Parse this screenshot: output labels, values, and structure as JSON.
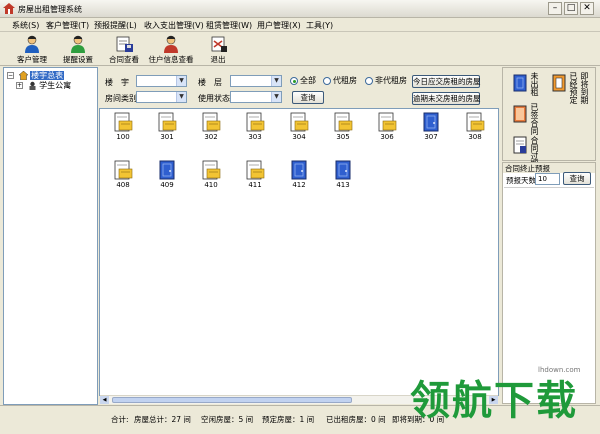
{
  "window": {
    "title": "房屋出租管理系统",
    "min_glyph": "–",
    "max_glyph": "□",
    "close_glyph": "✕"
  },
  "menu": [
    "系统(S)",
    "客户管理(T)",
    "预报提醒(L)",
    "收入支出管理(V)",
    "租赁管理(W)",
    "用户管理(X)",
    "工具(Y)"
  ],
  "toolbar": [
    {
      "label": "客户管理",
      "icon": "customer-icon"
    },
    {
      "label": "提醒设置",
      "icon": "reminder-icon"
    },
    {
      "label": "合同查看",
      "icon": "contract-icon"
    },
    {
      "label": "住户信息查看",
      "icon": "tenant-info-icon"
    },
    {
      "label": "退出",
      "icon": "exit-icon"
    }
  ],
  "tree": {
    "root": "楼宇总表",
    "child": "学生公寓"
  },
  "filter": {
    "building_label": "楼　宇",
    "floor_label": "楼　层",
    "room_type_label": "房间类别",
    "usage_label": "使用状态",
    "radio_all": "全部",
    "radio_agent": "代租房",
    "radio_non_agent": "非代租房",
    "query_button": "查询",
    "due_today_button": "今日应交房租的房屋",
    "overdue_button": "逾期未交房租的房屋"
  },
  "rooms": [
    {
      "num": "100",
      "status": "rented"
    },
    {
      "num": "301",
      "status": "rented"
    },
    {
      "num": "302",
      "status": "rented"
    },
    {
      "num": "303",
      "status": "rented"
    },
    {
      "num": "304",
      "status": "rented"
    },
    {
      "num": "305",
      "status": "rented"
    },
    {
      "num": "306",
      "status": "rented"
    },
    {
      "num": "307",
      "status": "vacant"
    },
    {
      "num": "308",
      "status": "rented"
    },
    {
      "num": "408",
      "status": "rented"
    },
    {
      "num": "409",
      "status": "vacant"
    },
    {
      "num": "410",
      "status": "rented"
    },
    {
      "num": "411",
      "status": "rented"
    },
    {
      "num": "412",
      "status": "vacant"
    },
    {
      "num": "413",
      "status": "vacant"
    }
  ],
  "legend": {
    "vacant": "未出租",
    "reserved": "已经预定",
    "expiring": "即将到期",
    "signed": "已签合同",
    "expired": "合同过期"
  },
  "contract_panel": {
    "title": "合同终止预报",
    "days_label": "预报天数",
    "days_value": "10",
    "query_button": "查询"
  },
  "status": {
    "total_label": "合计:",
    "total": "房屋总计：27 间",
    "vacant": "空闲房屋：5 间",
    "reserved": "预定房屋：1 间",
    "rented": "已出租房屋：0 间",
    "expiring": "即将到期：0 间"
  },
  "watermark": {
    "site": "lhdown.com",
    "text": "领航下载"
  },
  "colors": {
    "selection": "#316ac5",
    "rented_yellow": "#f2c433",
    "vacant_blue": "#2f5fcf",
    "watermark_green": "#1f9a3a"
  }
}
